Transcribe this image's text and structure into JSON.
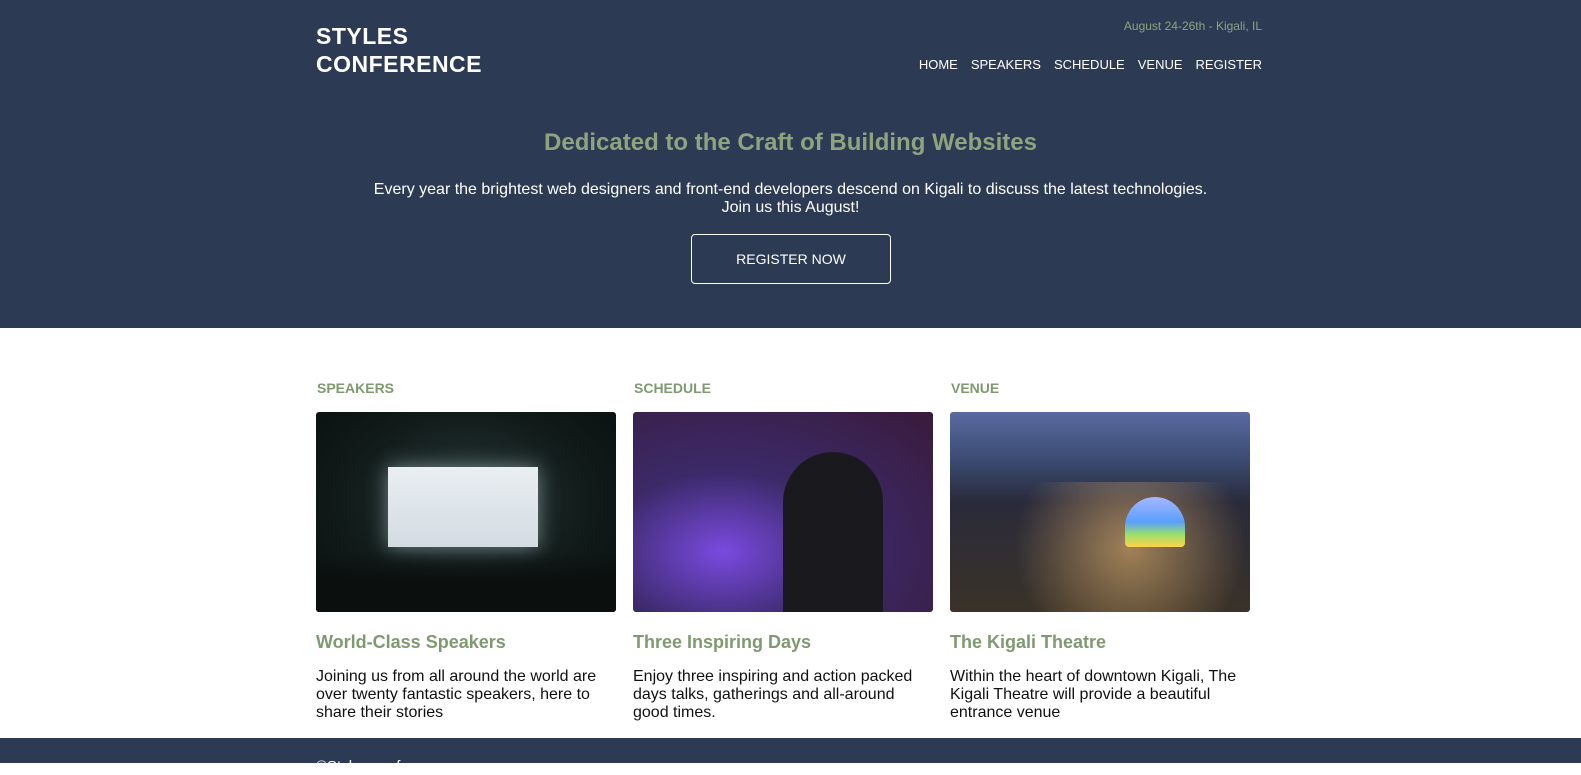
{
  "header": {
    "logo_line1": "STYLES",
    "logo_line2": "CONFERENCE",
    "date_location": "August 24-26th - Kigali, IL",
    "nav": [
      "HOME",
      "SPEAKERS",
      "SCHEDULE",
      "VENUE",
      "REGISTER"
    ]
  },
  "hero": {
    "title": "Dedicated to the Craft of Building Websites",
    "text_line1": "Every year the brightest web designers and front-end developers descend on Kigali to discuss the latest technologies.",
    "text_line2": "Join us this August!",
    "cta": "REGISTER NOW"
  },
  "cards": [
    {
      "label": "SPEAKERS",
      "title": "World-Class Speakers",
      "text": "Joining us from all around the world are over twenty fantastic speakers, here to share their stories"
    },
    {
      "label": "SCHEDULE",
      "title": "Three Inspiring Days",
      "text": "Enjoy three inspiring and action packed days talks, gatherings and all-around good times."
    },
    {
      "label": "VENUE",
      "title": "The Kigali Theatre",
      "text": "Within the heart of downtown Kigali, The Kigali Theatre will provide a beautiful entrance venue"
    }
  ],
  "footer": {
    "text": "©Styles conf"
  },
  "colors": {
    "navy": "#2c3a54",
    "accent_green": "#8fa37f"
  }
}
